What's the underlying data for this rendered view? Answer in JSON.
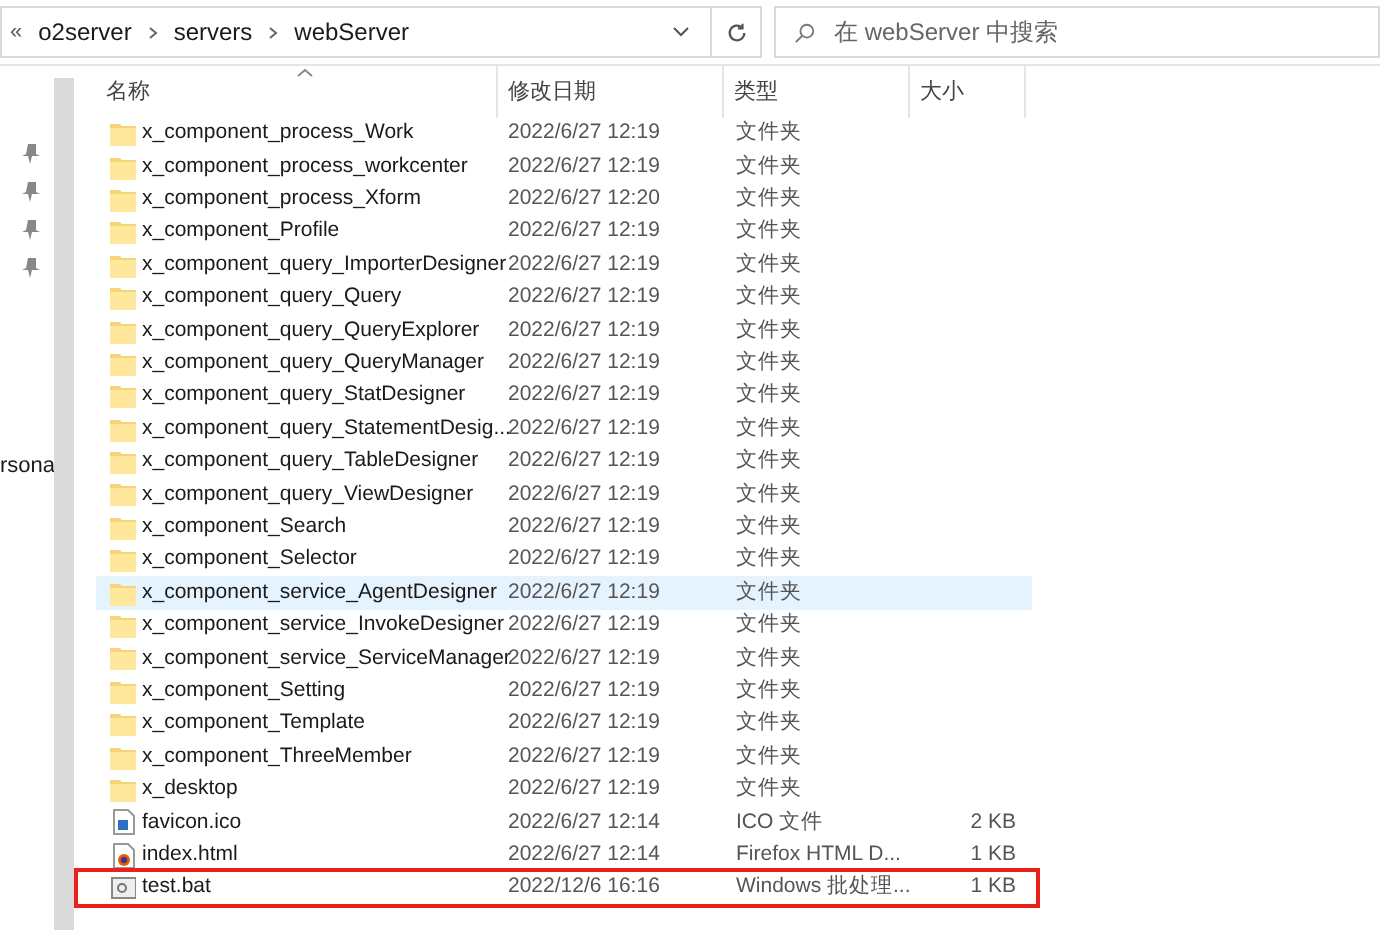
{
  "address_bar": {
    "overflow": "«",
    "path": [
      "o2server",
      "servers",
      "webServer"
    ]
  },
  "search": {
    "placeholder": "在 webServer 中搜索"
  },
  "sidebar": {
    "texts": [
      "rsona"
    ]
  },
  "columns": [
    "名称",
    "修改日期",
    "类型",
    "大小"
  ],
  "rows": [
    {
      "kind": "folder",
      "name": "x_component_process_Work",
      "date": "2022/6/27 12:19",
      "type": "文件夹",
      "selected": false,
      "boxed": false
    },
    {
      "kind": "folder",
      "name": "x_component_process_workcenter",
      "date": "2022/6/27 12:19",
      "type": "文件夹",
      "selected": false,
      "boxed": false
    },
    {
      "kind": "folder",
      "name": "x_component_process_Xform",
      "date": "2022/6/27 12:20",
      "type": "文件夹",
      "selected": false,
      "boxed": false
    },
    {
      "kind": "folder",
      "name": "x_component_Profile",
      "date": "2022/6/27 12:19",
      "type": "文件夹",
      "selected": false,
      "boxed": false
    },
    {
      "kind": "folder",
      "name": "x_component_query_ImporterDesigner",
      "date": "2022/6/27 12:19",
      "type": "文件夹",
      "selected": false,
      "boxed": false
    },
    {
      "kind": "folder",
      "name": "x_component_query_Query",
      "date": "2022/6/27 12:19",
      "type": "文件夹",
      "selected": false,
      "boxed": false
    },
    {
      "kind": "folder",
      "name": "x_component_query_QueryExplorer",
      "date": "2022/6/27 12:19",
      "type": "文件夹",
      "selected": false,
      "boxed": false
    },
    {
      "kind": "folder",
      "name": "x_component_query_QueryManager",
      "date": "2022/6/27 12:19",
      "type": "文件夹",
      "selected": false,
      "boxed": false
    },
    {
      "kind": "folder",
      "name": "x_component_query_StatDesigner",
      "date": "2022/6/27 12:19",
      "type": "文件夹",
      "selected": false,
      "boxed": false
    },
    {
      "kind": "folder",
      "name": "x_component_query_StatementDesig...",
      "date": "2022/6/27 12:19",
      "type": "文件夹",
      "selected": false,
      "boxed": false
    },
    {
      "kind": "folder",
      "name": "x_component_query_TableDesigner",
      "date": "2022/6/27 12:19",
      "type": "文件夹",
      "selected": false,
      "boxed": false
    },
    {
      "kind": "folder",
      "name": "x_component_query_ViewDesigner",
      "date": "2022/6/27 12:19",
      "type": "文件夹",
      "selected": false,
      "boxed": false
    },
    {
      "kind": "folder",
      "name": "x_component_Search",
      "date": "2022/6/27 12:19",
      "type": "文件夹",
      "selected": false,
      "boxed": false
    },
    {
      "kind": "folder",
      "name": "x_component_Selector",
      "date": "2022/6/27 12:19",
      "type": "文件夹",
      "selected": false,
      "boxed": false
    },
    {
      "kind": "folder",
      "name": "x_component_service_AgentDesigner",
      "date": "2022/6/27 12:19",
      "type": "文件夹",
      "selected": true,
      "boxed": false
    },
    {
      "kind": "folder",
      "name": "x_component_service_InvokeDesigner",
      "date": "2022/6/27 12:19",
      "type": "文件夹",
      "selected": false,
      "boxed": false
    },
    {
      "kind": "folder",
      "name": "x_component_service_ServiceManager",
      "date": "2022/6/27 12:19",
      "type": "文件夹",
      "selected": false,
      "boxed": false
    },
    {
      "kind": "folder",
      "name": "x_component_Setting",
      "date": "2022/6/27 12:19",
      "type": "文件夹",
      "selected": false,
      "boxed": false
    },
    {
      "kind": "folder",
      "name": "x_component_Template",
      "date": "2022/6/27 12:19",
      "type": "文件夹",
      "selected": false,
      "boxed": false
    },
    {
      "kind": "folder",
      "name": "x_component_ThreeMember",
      "date": "2022/6/27 12:19",
      "type": "文件夹",
      "selected": false,
      "boxed": false
    },
    {
      "kind": "folder",
      "name": "x_desktop",
      "date": "2022/6/27 12:19",
      "type": "文件夹",
      "selected": false,
      "boxed": false
    },
    {
      "kind": "image",
      "name": "favicon.ico",
      "date": "2022/6/27 12:14",
      "type": "ICO 文件",
      "size": "2 KB",
      "selected": false,
      "boxed": false
    },
    {
      "kind": "html",
      "name": "index.html",
      "date": "2022/6/27 12:14",
      "type": "Firefox HTML D...",
      "size": "1 KB",
      "selected": false,
      "boxed": false
    },
    {
      "kind": "batch",
      "name": "test.bat",
      "date": "2022/12/6 16:16",
      "type": "Windows 批处理...",
      "size": "1 KB",
      "selected": false,
      "boxed": true
    }
  ]
}
